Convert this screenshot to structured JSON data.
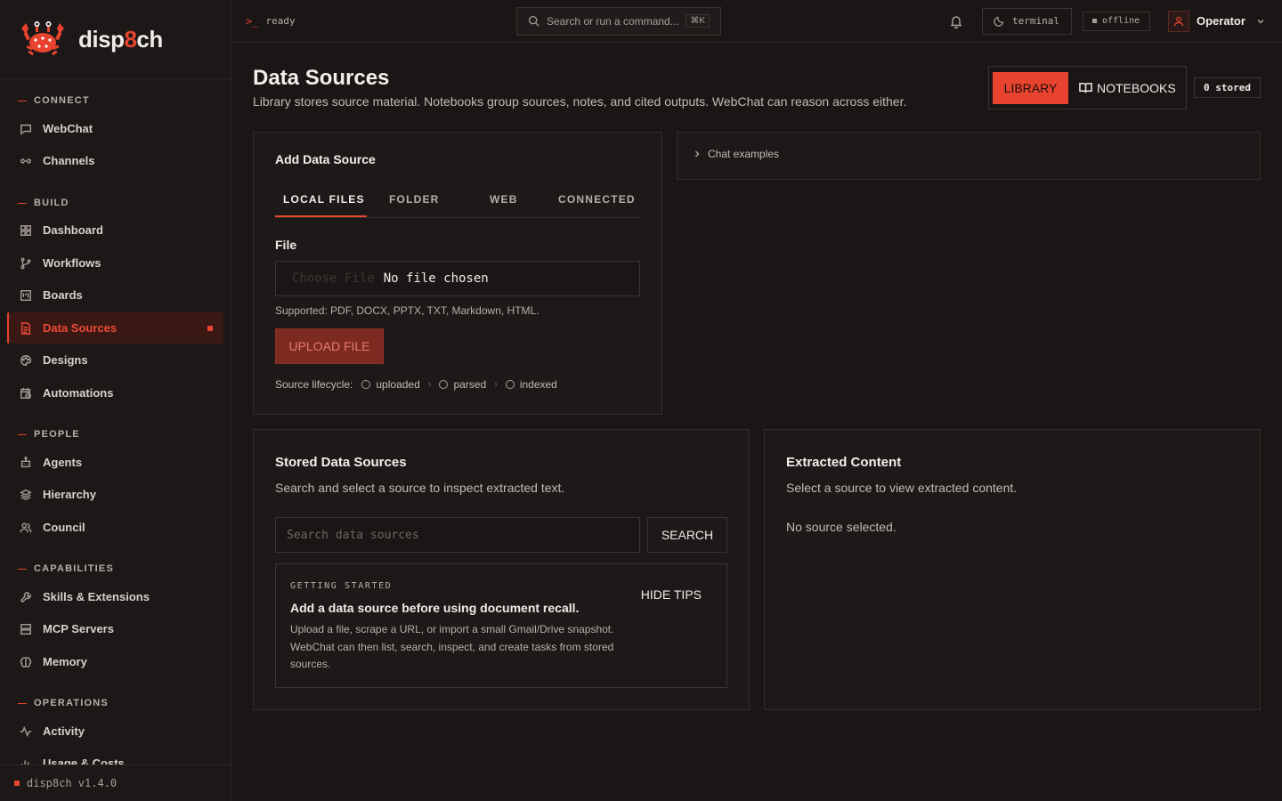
{
  "brand": {
    "name_prefix": "disp",
    "name_accent": "8",
    "name_suffix": "ch",
    "version": "disp8ch v1.4.0"
  },
  "sidebar": {
    "sections": [
      {
        "title": "CONNECT",
        "items": [
          {
            "label": "WebChat",
            "icon": "chat-icon"
          },
          {
            "label": "Channels",
            "icon": "link-icon"
          }
        ]
      },
      {
        "title": "BUILD",
        "items": [
          {
            "label": "Dashboard",
            "icon": "grid-icon"
          },
          {
            "label": "Workflows",
            "icon": "branch-icon"
          },
          {
            "label": "Boards",
            "icon": "board-icon"
          },
          {
            "label": "Data Sources",
            "icon": "file-icon",
            "active": true
          },
          {
            "label": "Designs",
            "icon": "palette-icon"
          },
          {
            "label": "Automations",
            "icon": "calendar-clock-icon"
          }
        ]
      },
      {
        "title": "PEOPLE",
        "items": [
          {
            "label": "Agents",
            "icon": "robot-icon"
          },
          {
            "label": "Hierarchy",
            "icon": "layers-icon"
          },
          {
            "label": "Council",
            "icon": "users-icon"
          }
        ]
      },
      {
        "title": "CAPABILITIES",
        "items": [
          {
            "label": "Skills & Extensions",
            "icon": "wrench-icon"
          },
          {
            "label": "MCP Servers",
            "icon": "server-icon"
          },
          {
            "label": "Memory",
            "icon": "brain-icon"
          }
        ]
      },
      {
        "title": "OPERATIONS",
        "items": [
          {
            "label": "Activity",
            "icon": "activity-icon"
          },
          {
            "label": "Usage & Costs",
            "icon": "bar-chart-icon"
          }
        ]
      }
    ]
  },
  "topbar": {
    "status_prompt": ">_",
    "status": "ready",
    "search_placeholder": "Search or run a command...",
    "search_shortcut": "⌘K",
    "theme_label": "terminal",
    "connection": "offline",
    "user": "Operator"
  },
  "page": {
    "title": "Data Sources",
    "subtitle": "Library stores source material. Notebooks group sources, notes, and cited outputs. WebChat can reason across either.",
    "view_library": "LIBRARY",
    "view_notebooks": "NOTEBOOKS",
    "stored_count": "0 stored"
  },
  "add_source": {
    "title": "Add Data Source",
    "tabs": [
      "LOCAL FILES",
      "FOLDER",
      "WEB",
      "CONNECTED"
    ],
    "active_tab": "LOCAL FILES",
    "file_label": "File",
    "choose_file": "Choose File",
    "no_file": "No file chosen",
    "supported": "Supported: PDF, DOCX, PPTX, TXT, Markdown, HTML.",
    "upload": "UPLOAD FILE",
    "lifecycle_label": "Source lifecycle:",
    "lifecycle_steps": [
      "uploaded",
      "parsed",
      "indexed"
    ]
  },
  "chat_examples": {
    "label": "Chat examples"
  },
  "stored_sources": {
    "title": "Stored Data Sources",
    "description": "Search and select a source to inspect extracted text.",
    "search_placeholder": "Search data sources",
    "search_button": "SEARCH",
    "tips": {
      "kicker": "GETTING STARTED",
      "headline": "Add a data source before using document recall.",
      "body": "Upload a file, scrape a URL, or import a small Gmail/Drive snapshot. WebChat can then list, search, inspect, and create tasks from stored sources.",
      "hide": "HIDE TIPS"
    }
  },
  "extracted": {
    "title": "Extracted Content",
    "description": "Select a source to view extracted content.",
    "empty": "No source selected."
  },
  "colors": {
    "accent": "#e8432e",
    "background": "#1a1615",
    "active_nav_bg": "#3a1814"
  }
}
